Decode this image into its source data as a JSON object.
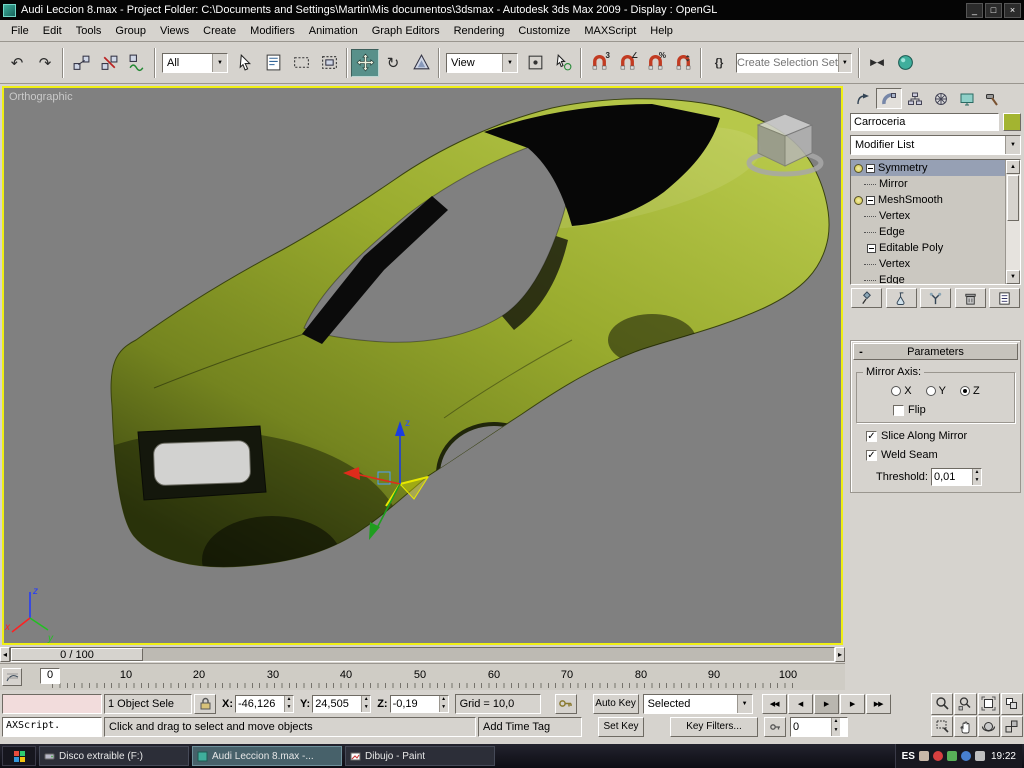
{
  "titlebar": {
    "title": "Audi Leccion 8.max    - Project Folder: C:\\Documents and Settings\\Martin\\Mis documentos\\3dsmax    - Autodesk 3ds Max  2009    - Display : OpenGL"
  },
  "menu": {
    "items": [
      "File",
      "Edit",
      "Tools",
      "Group",
      "Views",
      "Create",
      "Modifiers",
      "Animation",
      "Graph Editors",
      "Rendering",
      "Customize",
      "MAXScript",
      "Help"
    ]
  },
  "toolbar": {
    "filter_value": "All",
    "coord_value": "View",
    "selection_set_placeholder": "Create Selection Set"
  },
  "icons": {
    "minimize": "_",
    "maximize": "□",
    "close": "×",
    "undo": "↶",
    "redo": "↷",
    "rotate": "↻",
    "dropdown": "▼",
    "spin_up": "▲",
    "spin_down": "▼",
    "check": "✓",
    "minus": "-",
    "tri_left": "◂",
    "tri_right": "▸",
    "named_sets": "{}",
    "snap_3": "3",
    "snap_angle": "∠",
    "snap_percent": "%",
    "mirror": "▶◀",
    "play_start": "◀◀",
    "play_prev": "◀",
    "play": "▶",
    "play_next": "▶",
    "play_end": "▶▶"
  },
  "viewport": {
    "label": "Orthographic",
    "axis_x": "x",
    "axis_y": "y",
    "axis_z": "z",
    "gizmo_z": "z"
  },
  "timeline": {
    "slider_label": "0 / 100",
    "current_frame": "0",
    "ticks": [
      "0",
      "10",
      "20",
      "30",
      "40",
      "50",
      "60",
      "70",
      "80",
      "90",
      "100"
    ]
  },
  "panel": {
    "object_name": "Carroceria",
    "object_color": "#a3b430",
    "modifier_list": "Modifier List",
    "stack": [
      {
        "label": "Symmetry"
      },
      {
        "label": "Mirror"
      },
      {
        "label": "MeshSmooth"
      },
      {
        "label": "Vertex"
      },
      {
        "label": "Edge"
      },
      {
        "label": "Editable Poly"
      },
      {
        "label": "Vertex"
      },
      {
        "label": "Edge"
      }
    ],
    "params": {
      "title": "Parameters",
      "mirror_axis": "Mirror Axis:",
      "x": "X",
      "y": "Y",
      "z": "Z",
      "flip": "Flip",
      "slice": "Slice Along Mirror",
      "weld": "Weld Seam",
      "threshold_label": "Threshold:",
      "threshold_value": "0,01"
    }
  },
  "status": {
    "selection": "1 Object Sele",
    "x_label": "X:",
    "x_value": "-46,126",
    "y_label": "Y:",
    "y_value": "24,505",
    "z_label": "Z:",
    "z_value": "-0,19",
    "grid": "Grid = 10,0",
    "listener": "AXScript.",
    "prompt": "Click and drag to select and move objects",
    "time_tag": "Add Time Tag"
  },
  "anim": {
    "auto_key": "Auto Key",
    "set_key": "Set Key",
    "selected": "Selected",
    "key_filters": "Key Filters...",
    "frame": "0"
  },
  "taskbar": {
    "tasks": [
      {
        "label": "Disco extraible (F:)"
      },
      {
        "label": "Audi Leccion 8.max   -..."
      },
      {
        "label": "Dibujo - Paint"
      }
    ],
    "lang": "ES",
    "time": "19:22"
  }
}
